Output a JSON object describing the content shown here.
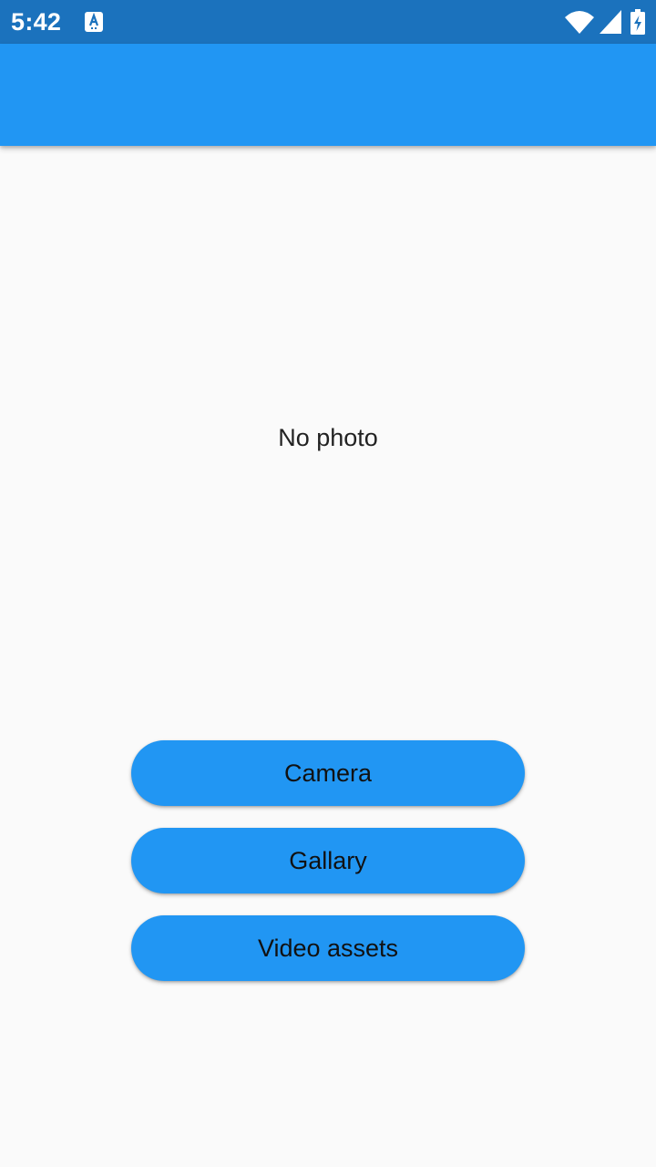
{
  "status_bar": {
    "time": "5:42",
    "background_color": "#1b72bd",
    "icons": [
      "app-notification-icon",
      "wifi-icon",
      "signal-icon",
      "battery-charging-icon"
    ]
  },
  "app_bar": {
    "title": "",
    "color": "#2196f3"
  },
  "main": {
    "empty_message": "No photo"
  },
  "buttons": {
    "camera": "Camera",
    "gallary": "Gallary",
    "video_assets": "Video assets",
    "color": "#2196f3"
  }
}
